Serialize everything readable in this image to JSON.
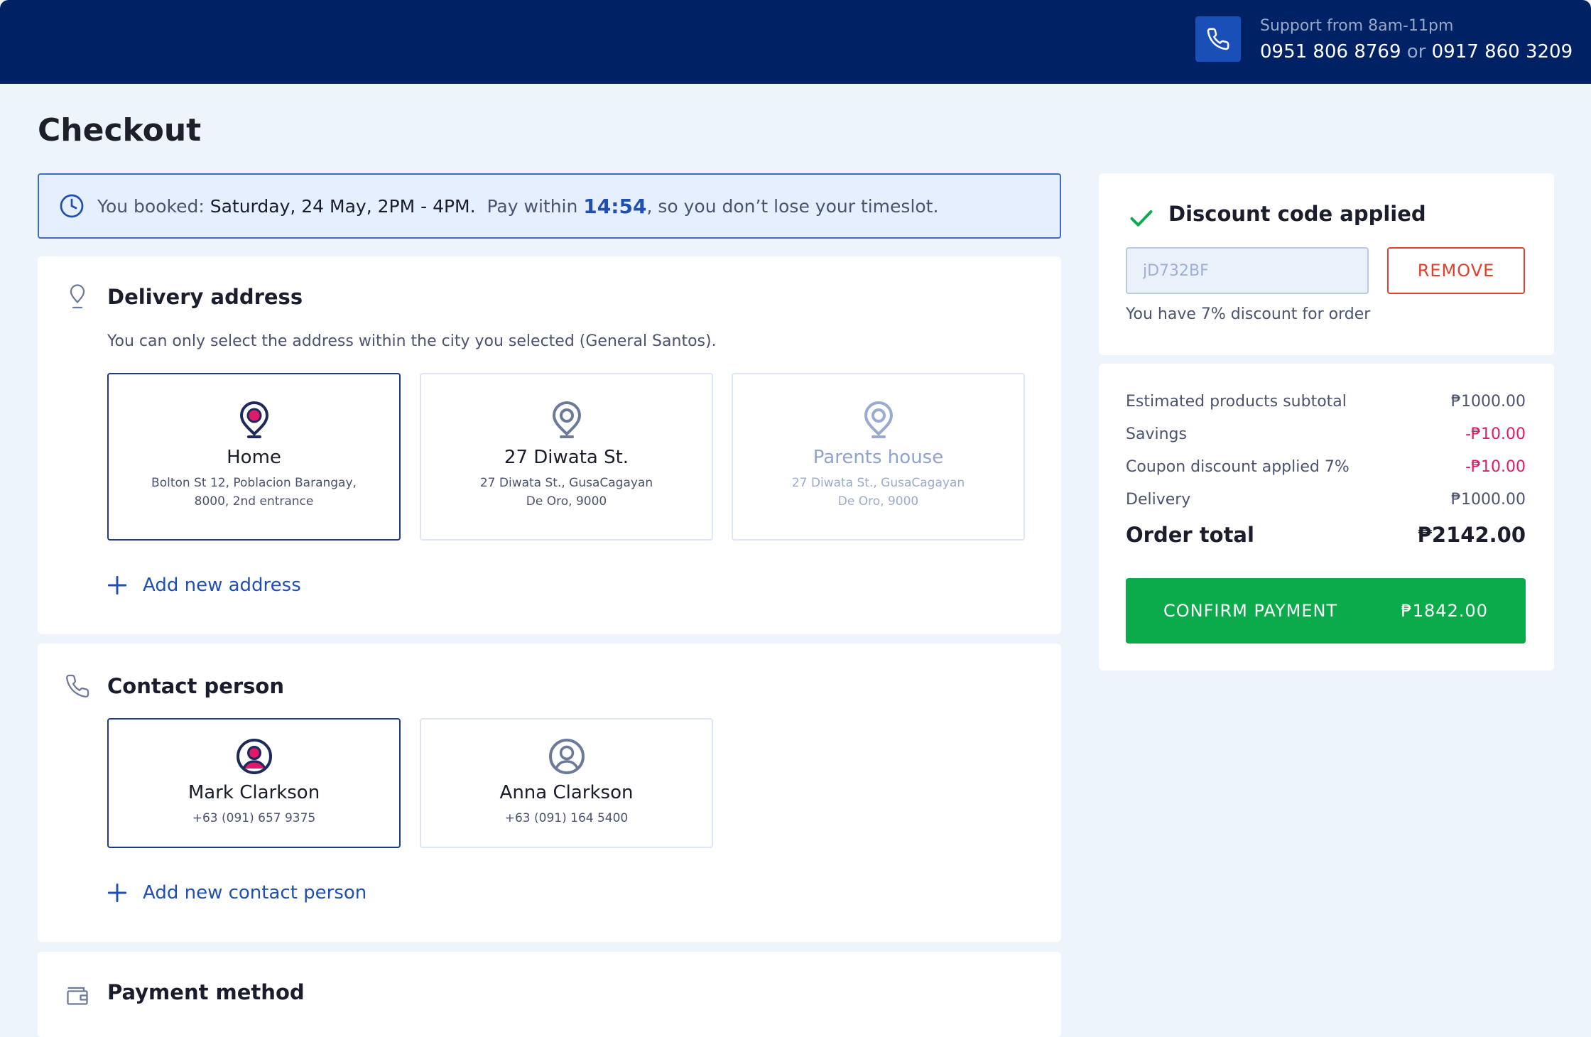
{
  "header": {
    "support_label": "Support from 8am-11pm",
    "phone_1": "0951 806 8769",
    "or_text": "or",
    "phone_2": "0917 860 3209",
    "icon": "phone-icon"
  },
  "page": {
    "title": "Checkout"
  },
  "booking": {
    "prefix": "You booked:",
    "slot": "Saturday, 24 May, 2PM - 4PM.",
    "pay_within": "Pay within",
    "timer": "14:54",
    "suffix": ", so you don’t lose your timeslot."
  },
  "delivery": {
    "title": "Delivery address",
    "note": "You can only select the address within the city you selected (General Santos).",
    "addresses": [
      {
        "name": "Home",
        "line1": "Bolton St 12, Poblacion Barangay,",
        "line2": "8000, 2nd entrance",
        "state": "selected"
      },
      {
        "name": "27 Diwata St.",
        "line1": "27 Diwata St., GusaCagayan",
        "line2": "De Oro, 9000",
        "state": "default"
      },
      {
        "name": "Parents house",
        "line1": "27 Diwata St., GusaCagayan",
        "line2": "De Oro, 9000",
        "state": "disabled"
      }
    ],
    "add_label": "Add new address"
  },
  "contact": {
    "title": "Contact person",
    "people": [
      {
        "name": "Mark Clarkson",
        "phone": "+63 (091) 657 9375",
        "state": "selected"
      },
      {
        "name": "Anna Clarkson",
        "phone": "+63 (091) 164 5400",
        "state": "default"
      }
    ],
    "add_label": "Add new contact person"
  },
  "payment": {
    "title": "Payment method"
  },
  "discount": {
    "title": "Discount code applied",
    "code": "jD732BF",
    "remove_label": "REMOVE",
    "note": "You have 7% discount for order"
  },
  "summary": {
    "rows": [
      {
        "label": "Estimated products subtotal",
        "value": "₱1000.00"
      },
      {
        "label": "Savings",
        "value": "-₱10.00"
      },
      {
        "label": "Coupon discount applied 7%",
        "value": "-₱10.00"
      },
      {
        "label": "Delivery",
        "value": "₱1000.00"
      }
    ],
    "total_label": "Order total",
    "total_value": "₱2142.00",
    "confirm_label": "CONFIRM PAYMENT",
    "confirm_amount": "₱1842.00"
  },
  "colors": {
    "header_bg": "#002163",
    "accent_blue": "#1f4fb4",
    "confirm_green": "#0bab4b",
    "remove_red": "#e0412c",
    "negative_pink": "#e0196b"
  }
}
